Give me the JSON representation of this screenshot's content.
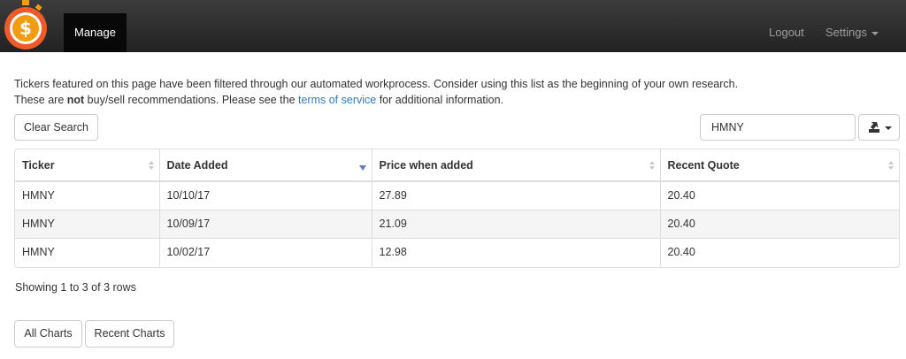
{
  "navbar": {
    "manage_label": "Manage",
    "logout_label": "Logout",
    "settings_label": "Settings",
    "logo_glyph": "$",
    "logo_color": "#f0541e"
  },
  "intro": {
    "line1": "Tickers featured on this page have been filtered through our automated workprocess. Consider using this list as the beginning of your own research.",
    "line2_before": "These are ",
    "line2_bold": "not",
    "line2_middle": " buy/sell recommendations. Please see the ",
    "line2_link": "terms of service",
    "line2_after": " for additional information."
  },
  "toolbar": {
    "clear_search_label": "Clear Search",
    "search_value": "HMNY",
    "export_icon": "export-icon"
  },
  "table": {
    "columns": [
      "Ticker",
      "Date Added",
      "Price when added",
      "Recent Quote"
    ],
    "rows": [
      [
        "HMNY",
        "10/10/17",
        "27.89",
        "20.40"
      ],
      [
        "HMNY",
        "10/09/17",
        "21.09",
        "20.40"
      ],
      [
        "HMNY",
        "10/02/17",
        "12.98",
        "20.40"
      ]
    ],
    "sorted_column": "Date Added",
    "sort_order": "desc"
  },
  "pagination": {
    "info": "Showing 1 to 3 of 3 rows"
  },
  "footer": {
    "all_charts_label": "All Charts",
    "recent_charts_label": "Recent Charts"
  },
  "colors": {
    "link": "#337ab7",
    "navbar_active": "#080808",
    "sort_active": "#5b7fcf"
  }
}
